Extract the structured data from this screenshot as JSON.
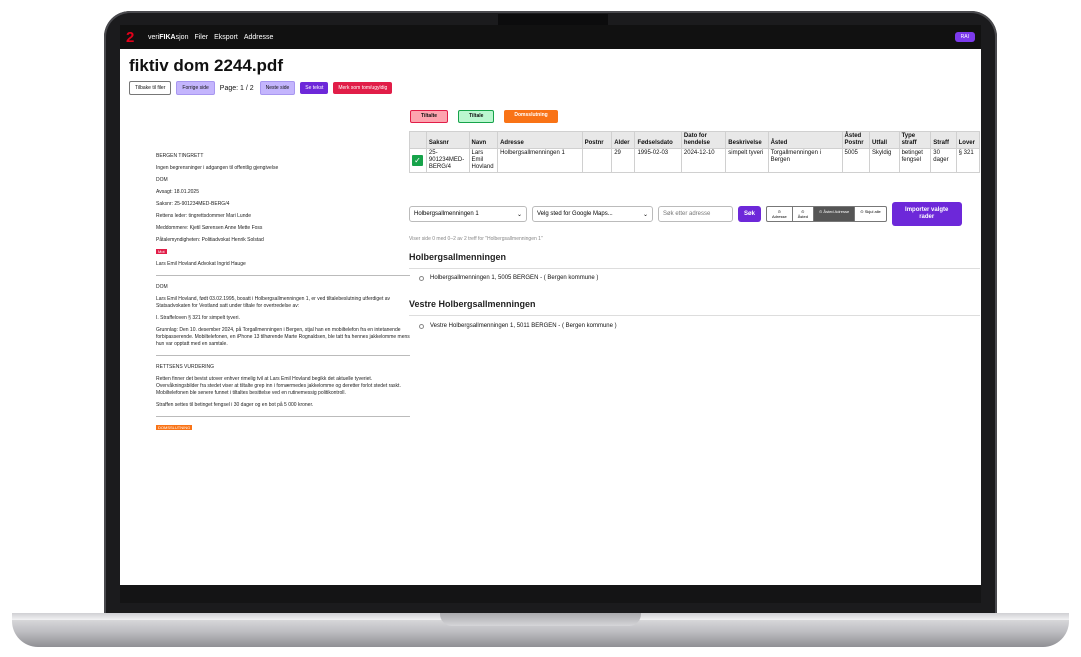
{
  "nav": {
    "logo": "2",
    "brand_prefix": "veri",
    "brand_mid": "FIKA",
    "brand_suffix": "sjon",
    "links": [
      "Filer",
      "Eksport",
      "Addresse"
    ],
    "user": "RAI"
  },
  "header": {
    "title": "fiktiv dom 2244.pdf",
    "buttons": {
      "back": "Tilbake til filer",
      "prev": "Forrige side",
      "page": "Page: 1 / 2",
      "next": "Neste side",
      "text": "Se tekst",
      "mark": "Merk som tom/ugyldig"
    }
  },
  "document": {
    "court": "BERGEN TINGRETT",
    "restriction": "Ingen begrensninger i adgangen til offentlig gjengivelse",
    "dom1": "DOM",
    "avsagt": "Avsagt: 18.01.2025",
    "saksnr": "Saksnr: 25-901234MED-BERG/4",
    "leder": "Rettens leder: tingrettsdommer Mari Lunde",
    "meddommere": "Meddommere: Kjetil Sørensen Anne Mette Foss",
    "patale": "Påtalemyndigheten: Politiadvokat Henrik Solstad",
    "tag_tiltalte": "Mot",
    "defendant": "Lars Emil Hovland Advokat Ingrid Hauge",
    "dom2": "DOM",
    "para1": "Lars Emil Hovland, født 03.02.1995, bosatt i Holbergsallmenningen 1, er ved tiltalebeslutning utferdiget av Statsadvokaten for Vestland satt under tiltale for overtredelse av:",
    "para2": "I. Straffeloven § 321 for simpelt tyveri.",
    "para3": "Grunnlag: Den 10. desember 2024, på Torgallmenningen i Bergen, stjal han en mobiltelefon fra en intetanende forbipasserende. Mobiltelefonen, en iPhone 13 tilhørende Marte Rognaldsen, ble tatt fra hennes jakkelomme mens hun var opptatt med en samtale.",
    "vurdering": "RETTSENS VURDERING",
    "para4": "Retten finner det bevist utover enhver rimelig tvil at Lars Emil Hovland begikk det aktuelle tyveriet. Overvåkningsbilder fra stedet viser at tiltalte grep inn i fornærmedes jakkelomme og deretter forlot stedet raskt. Mobiltelefonen ble senere funnet i tiltaltes besittelse ved en rutinemessig politikontroll.",
    "para5": "Straffen settes til betinget fengsel i 30 dager og en bot på 5 000 kroner.",
    "tag_domsslutning": "DOMSSLUTNING"
  },
  "tabs": {
    "tiltalte": "Tiltalte",
    "tiltale": "Tiltale",
    "domsslutning": "Domsslutning"
  },
  "table": {
    "headers": [
      "",
      "Saksnr",
      "Navn",
      "Adresse",
      "Postnr",
      "Alder",
      "Fødselsdato",
      "Dato for hendelse",
      "Beskrivelse",
      "Åsted",
      "Åsted Postnr",
      "Utfall",
      "Type straff",
      "Straff",
      "Lover"
    ],
    "row": {
      "saksnr": "25-901234MED-BERG/4",
      "navn": "Lars Emil Hovland",
      "adresse": "Holbergsallmenningen 1",
      "postnr": "",
      "alder": "29",
      "fodselsdato": "1995-02-03",
      "hendelse": "2024-12-10",
      "beskrivelse": "simpelt tyveri",
      "asted": "Torgallmenningen i Bergen",
      "asted_postnr": "5005",
      "utfall": "Skyldig",
      "type_straff": "betinget fengsel",
      "straff": "30 dager",
      "lover": "§ 321"
    }
  },
  "controls": {
    "address_select": "Holbergsallmenningen 1",
    "place_select": "Velg sted for Google Maps...",
    "search_placeholder": "Søk etter adresse",
    "search_button": "Søk",
    "seg": [
      "Adresse",
      "Åsted",
      "Åsted Adresse",
      "Skjul alle"
    ],
    "seg_icons": [
      "⊙",
      "⊙",
      "⊙",
      "⊙"
    ],
    "import_button": "Importer valgte rader"
  },
  "results": {
    "info": "Viser side 0 med 0–2 av 2 treff for \"Holbergsallmenningen 1\"",
    "group1": "Holbergsallmenningen",
    "item1": "Holbergsallmenningen 1, 5005 BERGEN - ( Bergen kommune )",
    "group2": "Vestre Holbergsallmenningen",
    "item2": "Vestre Holbergsallmenningen 1, 5011 BERGEN - ( Bergen kommune )"
  },
  "colors": {
    "accent": "#6d28d9",
    "danger": "#e11d48",
    "success": "#16a34a",
    "warning": "#f97316"
  }
}
